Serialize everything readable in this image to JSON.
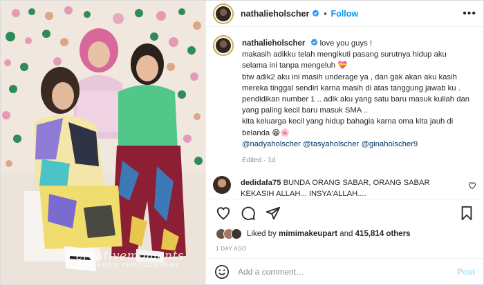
{
  "post": {
    "author": "nathalieholscher",
    "follow_label": "Follow",
    "more_label": "•••",
    "dot": "•"
  },
  "caption": {
    "username": "nathalieholscher",
    "lines": [
      "love you guys !",
      "makasih adikku telah mengikuti pasang surutnya hidup aku selama ini tanpa mengeluh 💝",
      "btw adik2 aku ini masih underage ya , dan gak akan aku kasih mereka tinggal sendiri karna masih di atas tanggung jawab ku .",
      "pendidikan number 1 .. adik aku yang satu baru masuk kuliah dan yang paling kecil baru masuk SMA ..",
      "kita keluarga kecil yang hidup bahagia karna oma kita jauh di belanda 😁🌸"
    ],
    "mentions": "@nadyaholscher @tasyaholscher @ginaholscher9",
    "meta": "Edited · 1d"
  },
  "comment": {
    "username": "dedidafa75",
    "text": "BUNDA ORANG SABAR, ORANG SABAR KEKASIH ALLAH... INSYA'ALLAH...."
  },
  "likes": {
    "prefix": "Liked by",
    "user": "mimimakeupart",
    "joiner": "and",
    "count": "415,814 others"
  },
  "time_ago": "1 DAY AGO",
  "add_comment": {
    "placeholder": "Add a comment…",
    "post_label": "Post"
  },
  "watermark": {
    "script": "creativemoments",
    "sub": "NEWBORN PHOTOGRAPHY"
  },
  "colors": {
    "follow": "#0095f6",
    "post_disabled": "#b2dffc",
    "verified": "#3897f0",
    "mention": "#00376b",
    "muted": "#8e8e8e"
  },
  "icons": [
    "verified-icon",
    "heart-icon",
    "comment-icon",
    "share-icon",
    "bookmark-icon",
    "emoji-icon",
    "more-icon"
  ]
}
